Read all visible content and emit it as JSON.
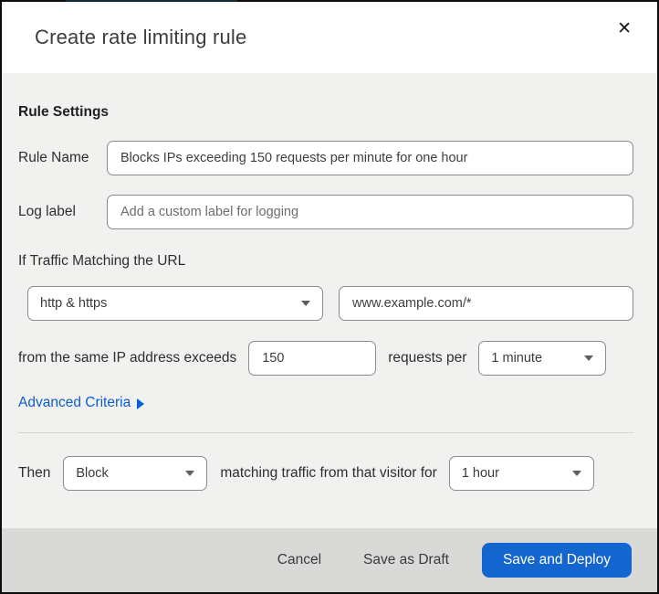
{
  "dialog": {
    "title": "Create rate limiting rule",
    "close_icon": "✕"
  },
  "colors": {
    "primary_button_blue": "#1365cf",
    "link_blue": "#0b5ed2",
    "body_background": "#f1f1ef",
    "footer_background": "#d9d9d7",
    "top_strip": "#132837"
  },
  "form": {
    "section_heading": "Rule Settings",
    "rule_name": {
      "label": "Rule Name",
      "value": "Blocks IPs exceeding 150 requests per minute for one hour"
    },
    "log_label": {
      "label": "Log label",
      "placeholder": "Add a custom label for logging"
    },
    "traffic_heading": "If Traffic Matching the URL",
    "scheme_select": {
      "value": "http & https"
    },
    "url_input": {
      "value": "www.example.com/*"
    },
    "threshold": {
      "prefix": "from the same IP address exceeds",
      "count_value": "150",
      "middle": "requests per",
      "period_select": {
        "value": "1 minute"
      }
    },
    "advanced_link": "Advanced Criteria",
    "then": {
      "label": "Then",
      "action_select": {
        "value": "Block"
      },
      "middle": "matching traffic from that visitor for",
      "duration_select": {
        "value": "1 hour"
      }
    }
  },
  "footer": {
    "cancel_label": "Cancel",
    "save_draft_label": "Save as Draft",
    "save_deploy_label": "Save and Deploy"
  }
}
